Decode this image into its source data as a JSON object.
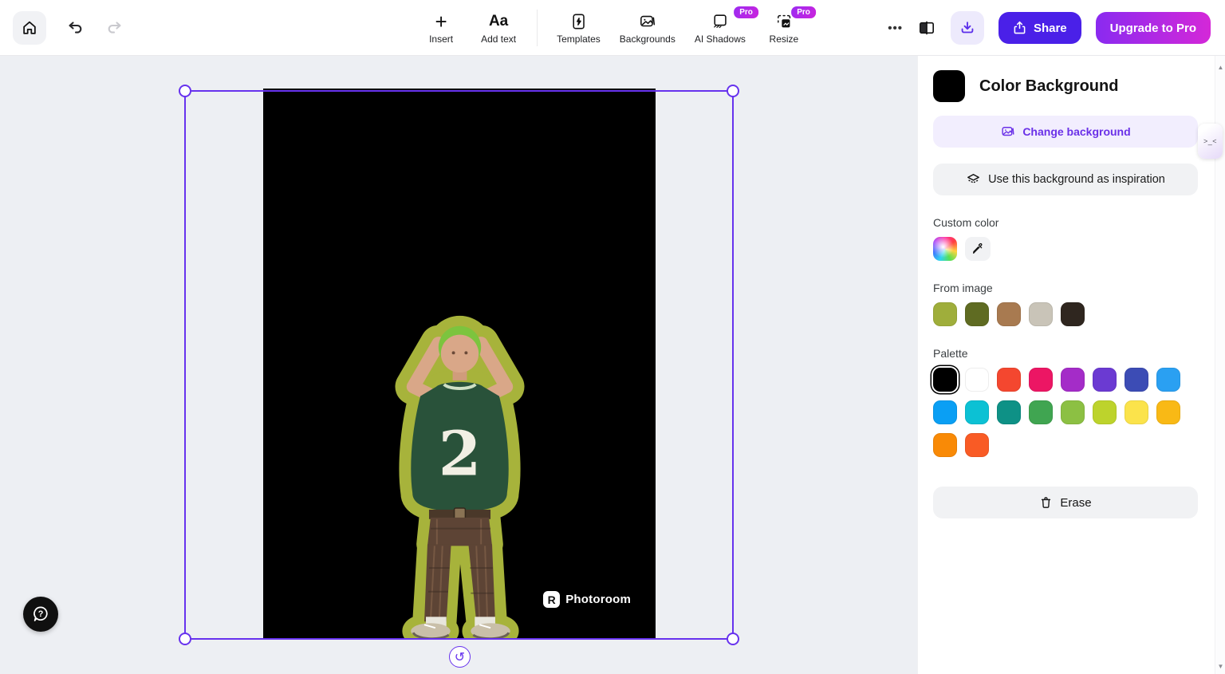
{
  "colors": {
    "accent": "#6732ee",
    "share-bg": "#4a20e8",
    "upgrade-start": "#8a2af0",
    "upgrade-end": "#d428d8",
    "pro-start": "#9b2bf2",
    "pro-end": "#cb24dc",
    "canvas-bg": "#edeff3"
  },
  "topbar": {
    "tools": [
      {
        "label": "Insert"
      },
      {
        "label": "Add text"
      },
      {
        "label": "Templates"
      },
      {
        "label": "Backgrounds"
      },
      {
        "label": "AI Shadows",
        "badge": "Pro"
      },
      {
        "label": "Resize",
        "badge": "Pro"
      }
    ],
    "add_text_glyph": "Aa",
    "insert_glyph": "+",
    "more_glyph": "•••",
    "share_label": "Share",
    "upgrade_label": "Upgrade to Pro"
  },
  "canvas": {
    "watermark_logo_glyph": "R",
    "watermark_text": "Photoroom",
    "rotate_glyph": "↺",
    "peek_tab_glyph": ">_<"
  },
  "sidebar": {
    "title": "Color Background",
    "current_color": "#000000",
    "change_background_label": "Change background",
    "inspiration_label": "Use this background as inspiration",
    "custom_color_label": "Custom color",
    "from_image_label": "From image",
    "palette_label": "Palette",
    "erase_label": "Erase",
    "from_image_colors": [
      "#9fae3b",
      "#5f6b22",
      "#a87a50",
      "#c9c4b8",
      "#2f261f"
    ],
    "palette_colors": [
      "#000000",
      "#ffffff",
      "#f4472f",
      "#ec1664",
      "#a42cc8",
      "#6b3ad2",
      "#3c4cb5",
      "#2aa0f2",
      "#0a9ff4",
      "#0cc1d4",
      "#0e9186",
      "#40a551",
      "#8cc043",
      "#bdd32c",
      "#fbe34b",
      "#f9b915",
      "#f98a06",
      "#f95b25"
    ],
    "palette_selected_index": 0
  },
  "scrollbar": {
    "up_glyph": "▲",
    "down_glyph": "▼"
  },
  "icons": {
    "home-icon": "house outline",
    "undo-icon": "curved arrow left",
    "redo-icon": "curved arrow right",
    "plus-icon": "+",
    "text-icon": "Aa",
    "template-icon": "document with lightning bolt",
    "backgrounds-icon": "photo frames",
    "ai-shadows-icon": "square with shadow hatching",
    "resize-icon": "dashed frame with image",
    "more-icon": "three dots",
    "compare-icon": "split panel",
    "download-icon": "arrow into tray",
    "share-icon": "box with up arrow",
    "image-icon": "picture",
    "layers-icon": "stacked layers",
    "eyedropper-icon": "color picker dropper",
    "trash-icon": "trash can",
    "help-icon": "question mark speech bubble",
    "rotate-icon": "↺"
  }
}
